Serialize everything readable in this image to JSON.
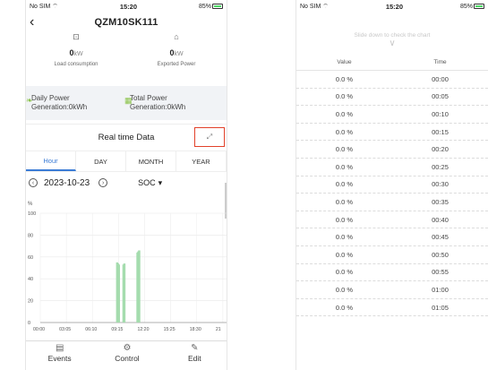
{
  "left": {
    "status": {
      "carrier": "No SIM",
      "time": "15:20",
      "battery": "85%"
    },
    "title": "QZM10SK111",
    "power": [
      {
        "value": "0",
        "unit": "kW",
        "label": "Load consumption"
      },
      {
        "value": "0",
        "unit": "kW",
        "label": "Exported Power"
      }
    ],
    "generation": [
      {
        "line1": "Daily Power",
        "line2": "Generation:0kWh"
      },
      {
        "line1": "Total Power",
        "line2": "Generation:0kWh"
      }
    ],
    "section_title": "Real time Data",
    "tabs": [
      "Hour",
      "DAY",
      "MONTH",
      "YEAR"
    ],
    "date": "2023-10-23",
    "metric": "SOC",
    "bottom_nav": [
      "Events",
      "Control",
      "Edit"
    ]
  },
  "chart_data": {
    "type": "bar",
    "ylabel": "%",
    "ylim": [
      0,
      100
    ],
    "yticks": [
      "0",
      "20",
      "40",
      "60",
      "80",
      "100"
    ],
    "xticks": [
      "00:00",
      "03:05",
      "06:10",
      "09:15",
      "12:20",
      "15:25",
      "18:30",
      "21"
    ],
    "series_color": "#a5dcae",
    "bars": [
      {
        "x_hours": 8.95,
        "value": 55
      },
      {
        "x_hours": 9.05,
        "value": 54
      },
      {
        "x_hours": 9.15,
        "value": 53
      },
      {
        "x_hours": 9.7,
        "value": 53
      },
      {
        "x_hours": 9.8,
        "value": 54
      },
      {
        "x_hours": 11.35,
        "value": 64
      },
      {
        "x_hours": 11.45,
        "value": 65
      },
      {
        "x_hours": 11.55,
        "value": 66
      }
    ]
  },
  "right": {
    "status": {
      "carrier": "No SIM",
      "time": "15:20",
      "battery": "85%"
    },
    "hint": "Slide down to check the chart",
    "columns": [
      "Value",
      "Time"
    ],
    "rows": [
      {
        "value": "0.0 %",
        "time": "00:00"
      },
      {
        "value": "0.0 %",
        "time": "00:05"
      },
      {
        "value": "0.0 %",
        "time": "00:10"
      },
      {
        "value": "0.0 %",
        "time": "00:15"
      },
      {
        "value": "0.0 %",
        "time": "00:20"
      },
      {
        "value": "0.0 %",
        "time": "00:25"
      },
      {
        "value": "0.0 %",
        "time": "00:30"
      },
      {
        "value": "0.0 %",
        "time": "00:35"
      },
      {
        "value": "0.0 %",
        "time": "00:40"
      },
      {
        "value": "0.0 %",
        "time": "00:45"
      },
      {
        "value": "0.0 %",
        "time": "00:50"
      },
      {
        "value": "0.0 %",
        "time": "00:55"
      },
      {
        "value": "0.0 %",
        "time": "01:00"
      },
      {
        "value": "0.0 %",
        "time": "01:05"
      }
    ]
  }
}
